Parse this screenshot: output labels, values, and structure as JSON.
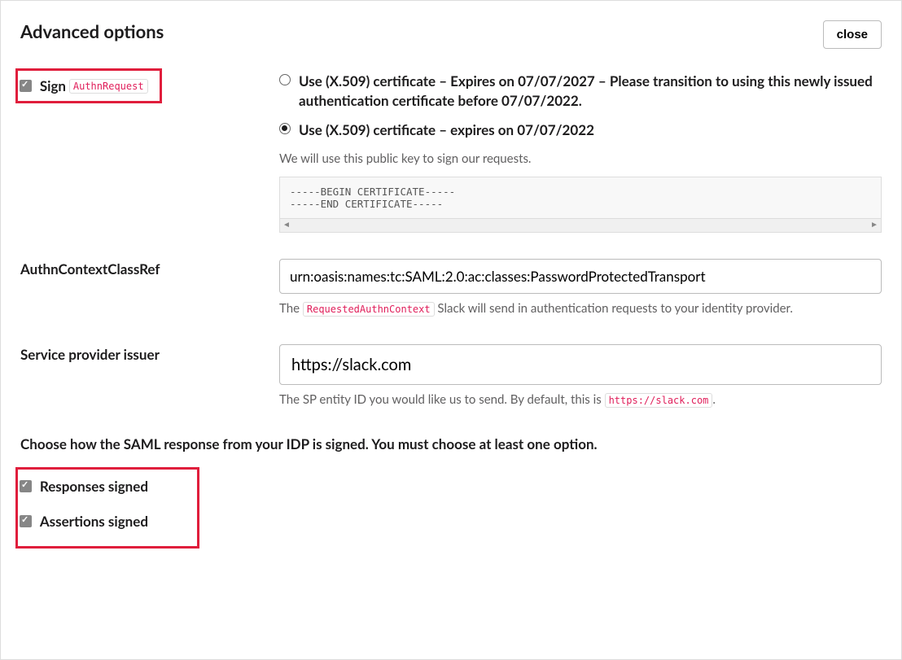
{
  "header": {
    "title": "Advanced options",
    "close_label": "close"
  },
  "sign": {
    "label": "Sign",
    "code": "AuthnRequest",
    "radios": [
      {
        "label": "Use (X.509) certificate – Expires on 07/07/2027 – Please transition to using this newly issued authentication certificate before 07/07/2022.",
        "selected": false
      },
      {
        "label": "Use (X.509) certificate – expires on 07/07/2022",
        "selected": true
      }
    ],
    "helper": "We will use this public key to sign our requests.",
    "cert_text": "-----BEGIN CERTIFICATE-----\n-----END CERTIFICATE-----"
  },
  "authn_context": {
    "label": "AuthnContextClassRef",
    "value": "urn:oasis:names:tc:SAML:2.0:ac:classes:PasswordProtectedTransport",
    "help_pre": "The ",
    "help_code": "RequestedAuthnContext",
    "help_post": " Slack will send in authentication requests to your identity provider."
  },
  "sp_issuer": {
    "label": "Service provider issuer",
    "value": "https://slack.com",
    "help_pre": "The SP entity ID you would like us to send. By default, this is ",
    "help_code": "https://slack.com",
    "help_post": "."
  },
  "signing_section": {
    "text": "Choose how the SAML response from your IDP is signed. You must choose at least one option.",
    "responses_label": "Responses signed",
    "assertions_label": "Assertions signed"
  }
}
